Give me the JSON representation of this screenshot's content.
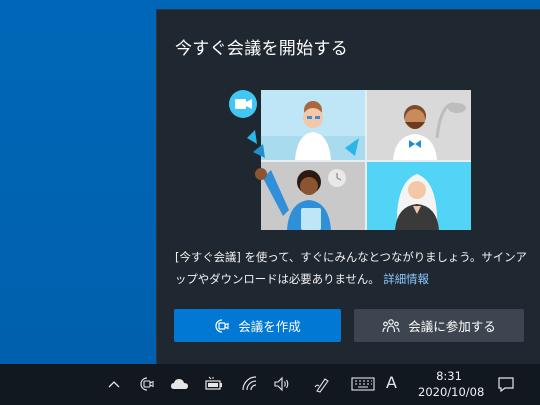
{
  "flyout": {
    "title": "今すぐ会議を開始する",
    "description_text": "[今すぐ会議] を使って、すぐにみんなとつながりましょう。サインアップやダウンロードは必要ありません。",
    "learn_more": "詳細情報",
    "create_button": "会議を作成",
    "join_button": "会議に参加する",
    "illustration_icon": "video-camera-icon"
  },
  "taskbar": {
    "tray_icons": [
      "chevron-up-icon",
      "meet-now-icon",
      "onedrive-icon",
      "battery-icon",
      "wifi-icon",
      "volume-icon",
      "pen-icon",
      "keyboard-icon"
    ],
    "ime_mode": "A",
    "time": "8:31",
    "date": "2020/10/08",
    "notification_icon": "action-center-icon"
  },
  "colors": {
    "desktop": "#0063b1",
    "flyout_bg": "#1f2730",
    "accent": "#0078d4",
    "secondary_button": "#3d4650",
    "link": "#8cc8ff",
    "taskbar": "#121820"
  }
}
